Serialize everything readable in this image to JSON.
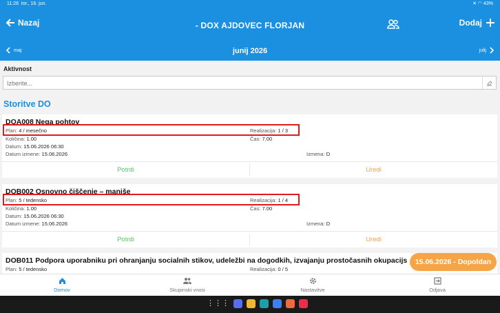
{
  "status": {
    "time": "11:26",
    "date": "tor., 16. jun.",
    "battery": "43%"
  },
  "header": {
    "back_label": "Nazaj",
    "title": "- DOX AJDOVEC FLORJAN",
    "add_label": "Dodaj"
  },
  "month_nav": {
    "prev_label": "maj",
    "current": "junij 2026",
    "next_label": "julij"
  },
  "filter": {
    "label": "Aktivnost",
    "placeholder": "Izberite..."
  },
  "section_title": "Storitve DO",
  "cards": [
    {
      "name": "DOA008 Nega pohtov",
      "plan_label": "Plan:",
      "plan_value": "4 / mesečno",
      "realizacija_label": "Realizacija:",
      "realizacija_value": "1 / 3",
      "kolicina_label": "Količina:",
      "kolicina_value": "1.00",
      "cas_label": "Čas:",
      "cas_value": "7.00",
      "datum_label": "Datum:",
      "datum_value": "15.06.2026 06:30",
      "datum_izmene_label": "Datum izmene:",
      "datum_izmene_value": "15.06.2026",
      "izmena_label": "Izmena:",
      "izmena_value": "D",
      "potrdi": "Potrdi",
      "uredi": "Uredi"
    },
    {
      "name": "DOB002 Osnovno čiščenje – manjše",
      "plan_label": "Plan:",
      "plan_value": "5 / tedensko",
      "realizacija_label": "Realizacija:",
      "realizacija_value": "1 / 4",
      "kolicina_label": "Količina:",
      "kolicina_value": "1.00",
      "cas_label": "Čas:",
      "cas_value": "7.00",
      "datum_label": "Datum:",
      "datum_value": "15.06.2026 06:30",
      "datum_izmene_label": "Datum izmene:",
      "datum_izmene_value": "15.06.2026",
      "izmena_label": "Izmena:",
      "izmena_value": "D",
      "potrdi": "Potrdi",
      "uredi": "Uredi"
    },
    {
      "name": "DOB011 Podpora uporabniku pri ohranjanju socialnih stikov, udeležbi na dogodkih, izvajanju prostočasnih okupacijs",
      "plan_label": "Plan:",
      "plan_value": "5 / tedensko",
      "realizacija_label": "Realizacija:",
      "realizacija_value": "0 / 5"
    }
  ],
  "shift_badge": "15.06.2026 - Dopoldan",
  "bottom_nav": [
    {
      "label": "Domov",
      "icon": "home-icon"
    },
    {
      "label": "Skupinski vnosi",
      "icon": "group-icon"
    },
    {
      "label": "Nastavitve",
      "icon": "gear-icon"
    },
    {
      "label": "Odjava",
      "icon": "logout-icon"
    }
  ],
  "colors": {
    "primary": "#1b8fe0",
    "confirm": "#58c46a",
    "edit": "#f5a14a",
    "badge": "#f7a446",
    "highlight": "#e0191b"
  }
}
